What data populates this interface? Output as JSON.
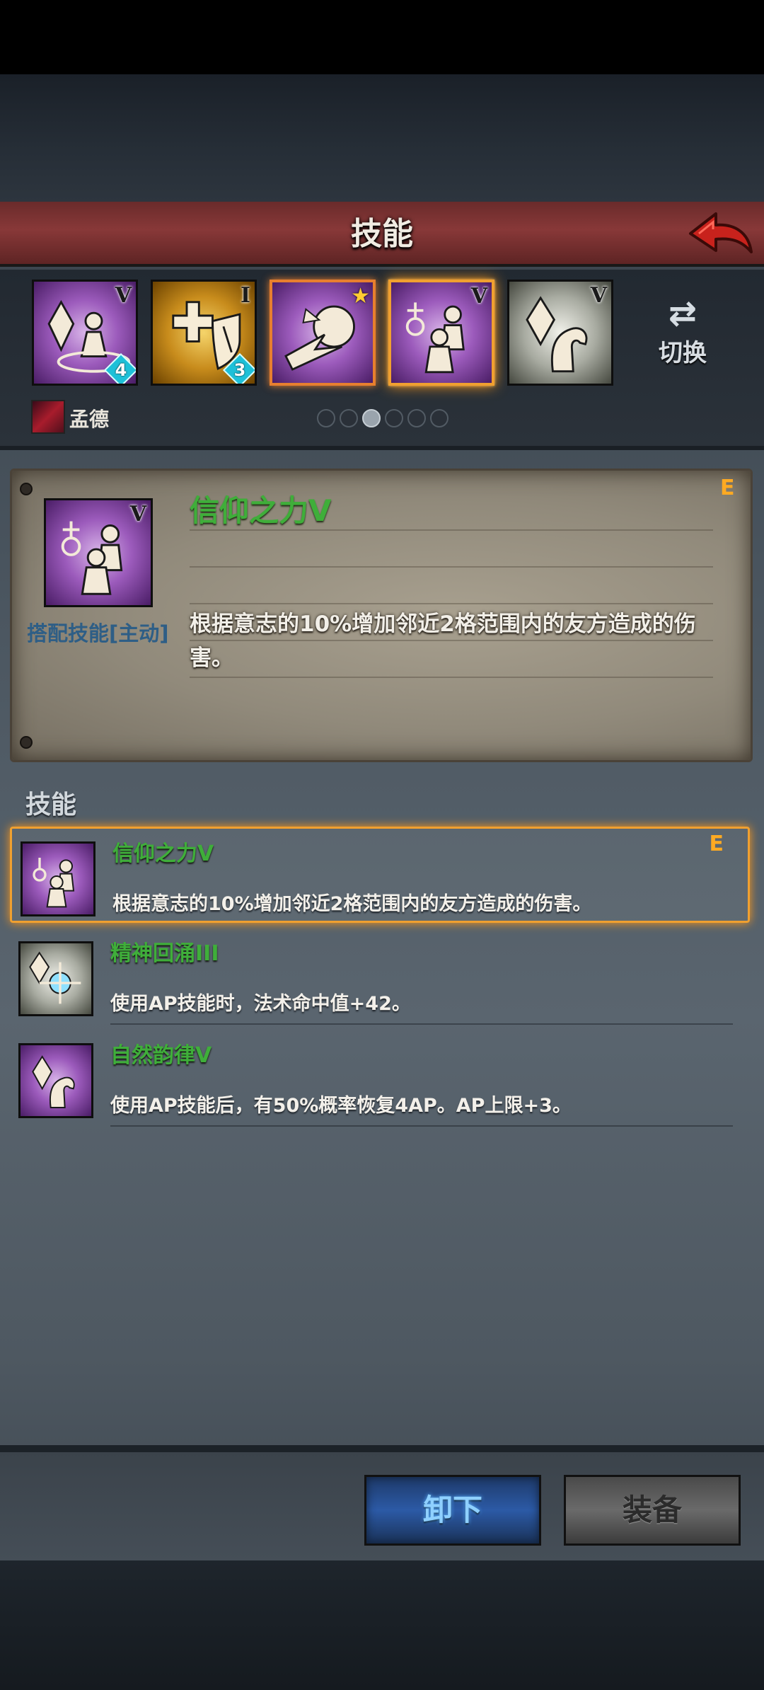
{
  "header": {
    "title": "技能",
    "back_icon": "back-arrow-icon",
    "accent": "#883838"
  },
  "skill_slots": [
    {
      "roman": "V",
      "badge": "4",
      "icon": "crystal-figure-icon",
      "theme": "purple"
    },
    {
      "roman": "I",
      "badge": "3",
      "icon": "cross-shield-icon",
      "theme": "gold"
    },
    {
      "roman": "",
      "badge": "",
      "icon": "shatter-icon",
      "theme": "purple",
      "star": "★"
    },
    {
      "roman": "V",
      "badge": "",
      "icon": "two-figures-icon",
      "theme": "purple",
      "selected": true
    },
    {
      "roman": "V",
      "badge": "",
      "icon": "crystal-hand-icon",
      "theme": "gray"
    }
  ],
  "switch": {
    "arrows": "⇄",
    "label": "切换"
  },
  "hero": {
    "name": "孟德"
  },
  "pager": {
    "pages": 6,
    "current": 3
  },
  "detail": {
    "title": "信仰之力V",
    "grade": "E",
    "caption": "搭配技能[主动]",
    "description": "根据意志的10%增加邻近2格范围内的友方造成的伤害。"
  },
  "skills_section": {
    "title": "技能",
    "items": [
      {
        "name": "信仰之力V",
        "desc": "根据意志的10%增加邻近2格范围内的友方造成的伤害。",
        "grade": "E",
        "selected": true
      },
      {
        "name": "精神回涌III",
        "desc": "使用AP技能时，法术命中值+42。",
        "grade": ""
      },
      {
        "name": "自然韵律V",
        "desc": "使用AP技能后，有50%概率恢复4AP。AP上限+3。",
        "grade": ""
      }
    ]
  },
  "footer": {
    "unequip_label": "卸下",
    "equip_label": "装备"
  }
}
